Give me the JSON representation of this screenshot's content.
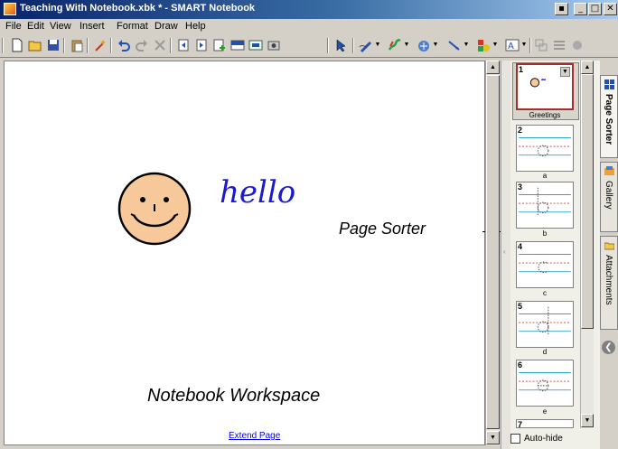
{
  "window": {
    "title": "Teaching With Notebook.xbk * - SMART Notebook",
    "restore_glyph": "▪",
    "minimize_glyph": "_",
    "maximize_glyph": "□",
    "close_glyph": "✕"
  },
  "menu": [
    "File",
    "Edit",
    "View",
    "Insert",
    "Format",
    "Draw",
    "Help"
  ],
  "toolbar": {
    "icons": [
      "new-page-icon",
      "open-file-icon",
      "save-icon",
      "paste-icon",
      "magic-pen-icon",
      "undo-icon",
      "redo-icon",
      "delete-icon",
      "previous-page-icon",
      "next-page-icon",
      "add-page-icon",
      "screen-shade-icon",
      "capture-icon",
      "select-arrow-icon",
      "pen-icon",
      "creative-pen-icon",
      "eraser-icon",
      "line-icon",
      "shapes-icon",
      "text-icon",
      "table-icon",
      "properties-icon"
    ]
  },
  "workspace": {
    "label": "Notebook Workspace",
    "handwriting": "hello",
    "extend_page_link": "Extend Page",
    "callout_label": "Page Sorter"
  },
  "sorter": {
    "pages": [
      {
        "num": "1",
        "caption": "Greetings",
        "selected": true
      },
      {
        "num": "2",
        "caption": "a",
        "selected": false
      },
      {
        "num": "3",
        "caption": "b",
        "selected": false
      },
      {
        "num": "4",
        "caption": "c",
        "selected": false
      },
      {
        "num": "5",
        "caption": "d",
        "selected": false
      },
      {
        "num": "6",
        "caption": "e",
        "selected": false
      },
      {
        "num": "7",
        "caption": "",
        "selected": false
      }
    ],
    "autohide_label": "Auto-hide",
    "grip_glyph": "‹"
  },
  "tabs": [
    {
      "label": "Page Sorter",
      "icon": "page-sorter-icon",
      "active": true
    },
    {
      "label": "Gallery",
      "icon": "gallery-icon",
      "active": false
    },
    {
      "label": "Attachments",
      "icon": "attachments-icon",
      "active": false
    }
  ],
  "nav": {
    "back_glyph": "❮"
  },
  "colors": {
    "titlebar": "#0a246a",
    "selected_page_border": "#a0302a",
    "link": "#0000ee",
    "face_fill": "#f7c89a",
    "ink_blue": "#1a1ad0"
  }
}
